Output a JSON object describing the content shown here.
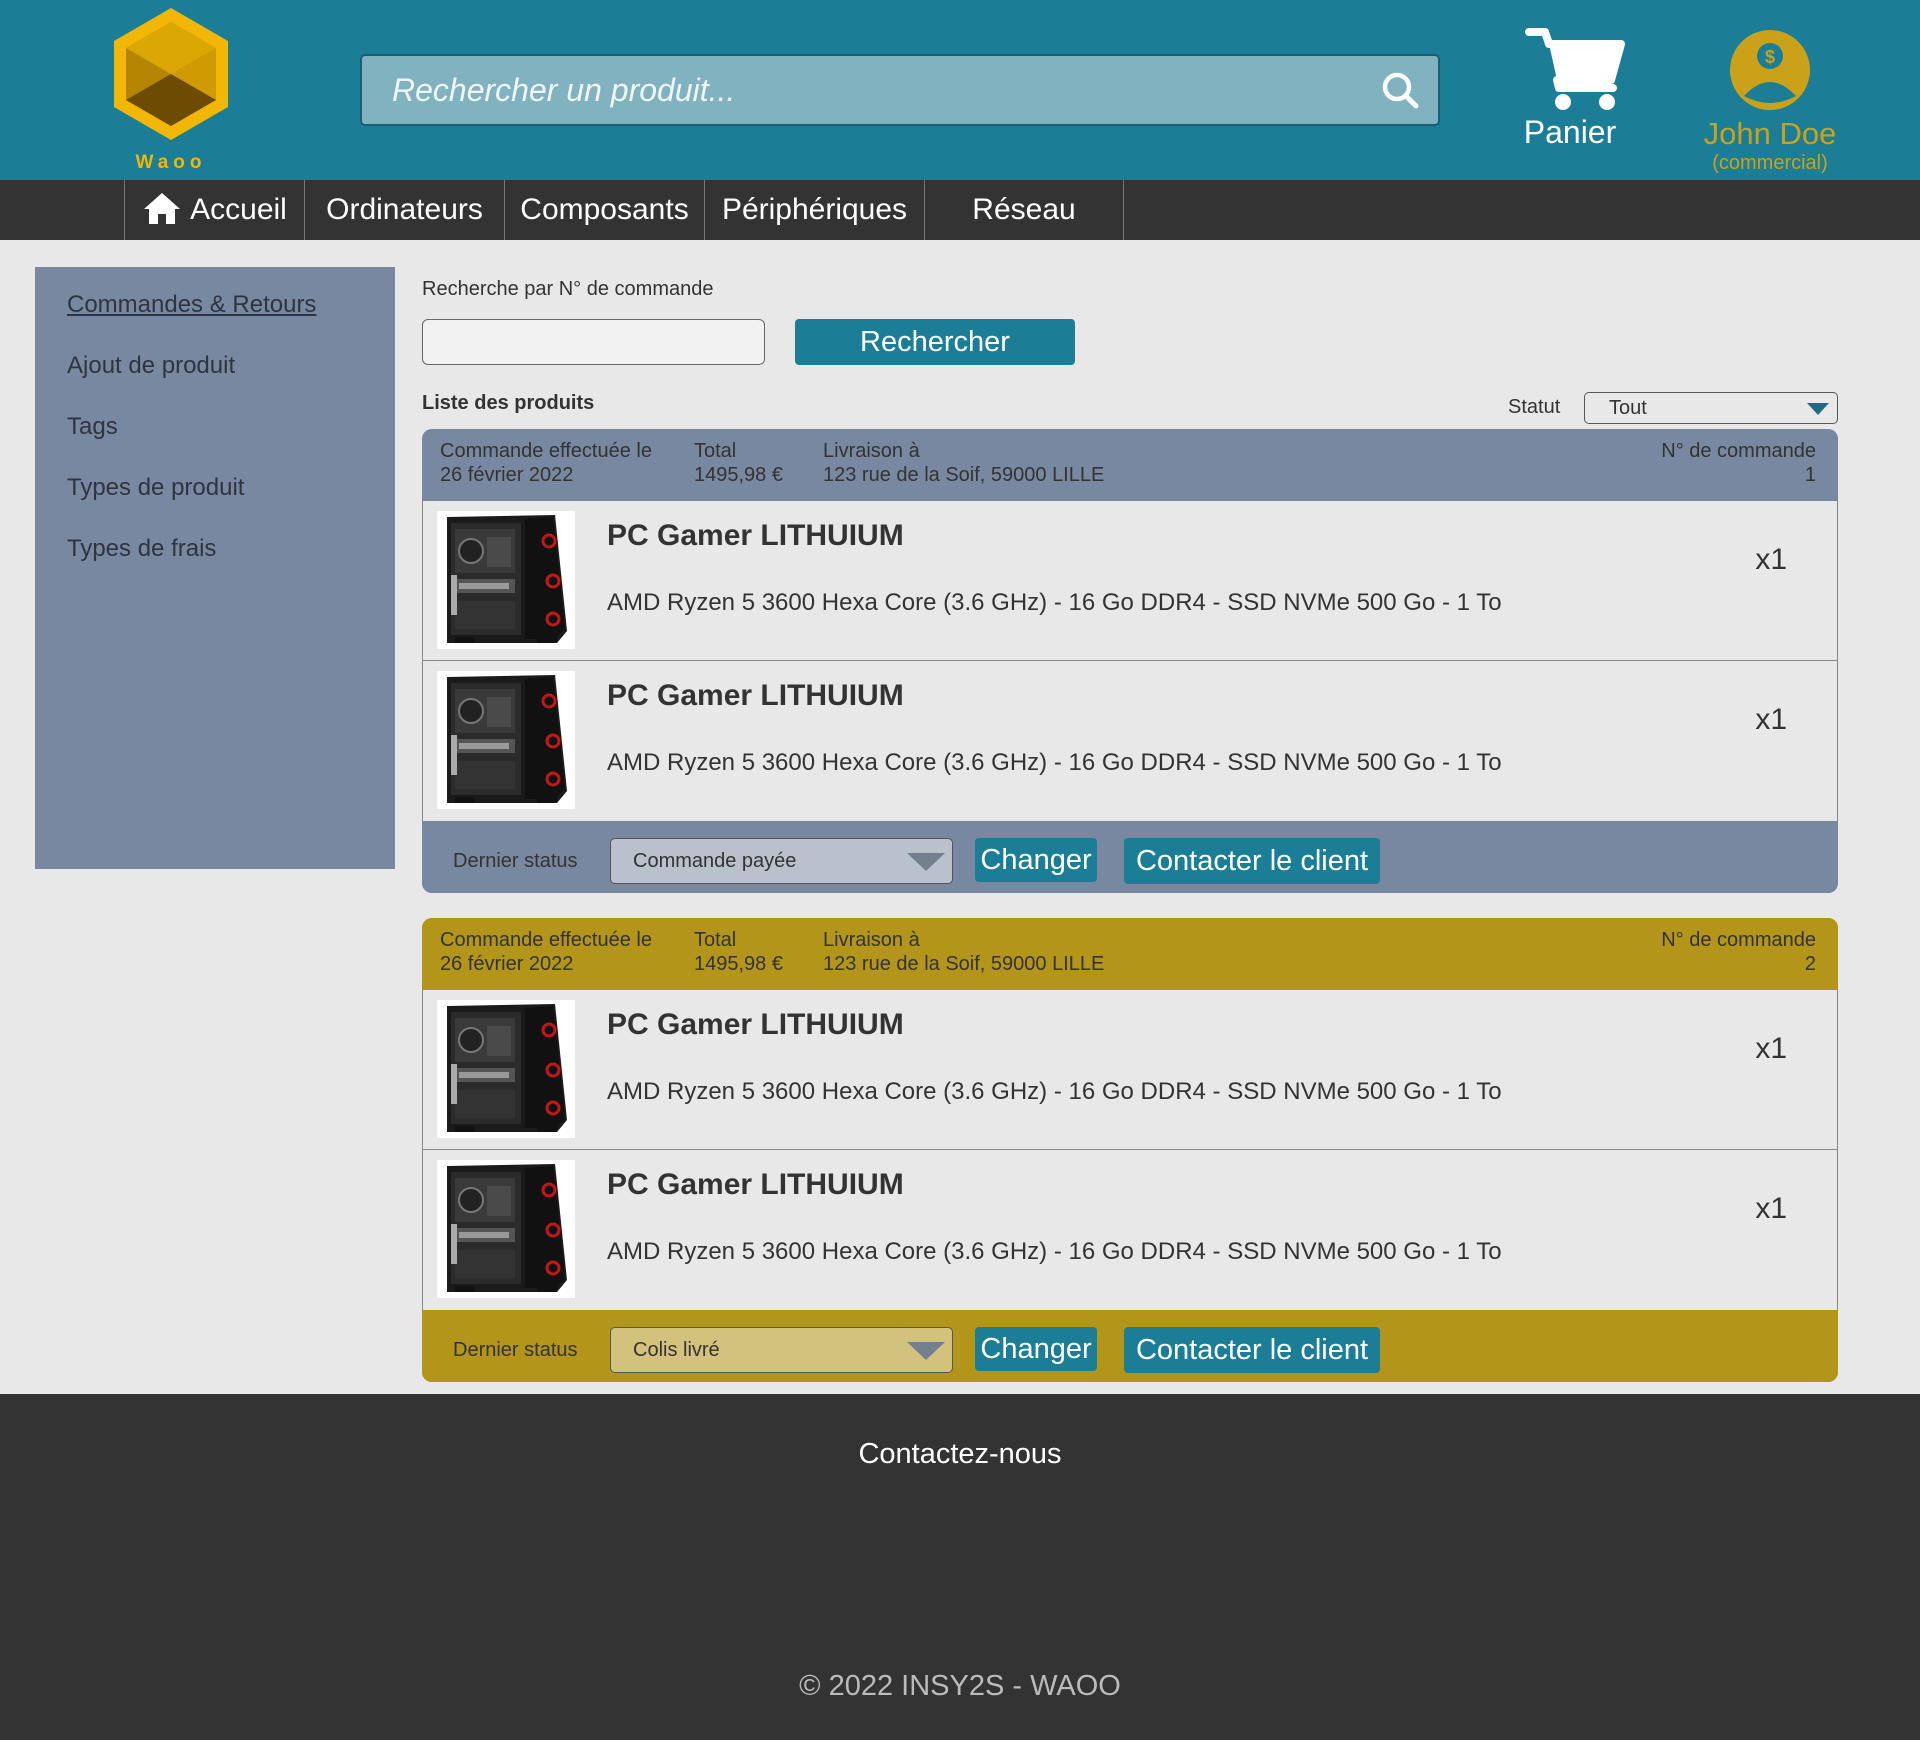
{
  "header": {
    "logo_text": "Waoo",
    "search_placeholder": "Rechercher un produit...",
    "cart_label": "Panier",
    "user_name": "John Doe",
    "user_role": "(commercial)"
  },
  "nav": {
    "items": [
      {
        "label": "Accueil",
        "icon": "home-icon"
      },
      {
        "label": "Ordinateurs"
      },
      {
        "label": "Composants"
      },
      {
        "label": "Périphériques"
      },
      {
        "label": "Réseau"
      }
    ]
  },
  "sidebar": {
    "items": [
      {
        "label": "Commandes & Retours"
      },
      {
        "label": "Ajout de produit"
      },
      {
        "label": "Tags"
      },
      {
        "label": "Types de produit"
      },
      {
        "label": "Types de frais"
      }
    ]
  },
  "order_search": {
    "label": "Recherche par N° de commande",
    "value": "",
    "button": "Rechercher"
  },
  "list": {
    "title": "Liste des produits",
    "statut_label": "Statut",
    "statut_value": "Tout"
  },
  "orders": [
    {
      "date_label": "Commande effectuée le",
      "date": "26 février 2022",
      "total_label": "Total",
      "total": "1495,98 €",
      "delivery_label": "Livraison à",
      "delivery": "123 rue de la Soif, 59000 LILLE",
      "number_label": "N° de commande",
      "number": "1",
      "color": "#7888a0",
      "select_color": "#b9c1cd",
      "items": [
        {
          "name": "PC Gamer LITHUIUM",
          "desc": "AMD Ryzen 5 3600 Hexa Core (3.6 GHz) - 16 Go DDR4 - SSD NVMe 500 Go - 1 To",
          "qty": "x1"
        },
        {
          "name": "PC Gamer LITHUIUM",
          "desc": "AMD Ryzen 5 3600 Hexa Core (3.6 GHz) - 16 Go DDR4 - SSD NVMe 500 Go - 1 To",
          "qty": "x1"
        }
      ],
      "status_label": "Dernier status",
      "status_value": "Commande payée",
      "change_button": "Changer",
      "contact_button": "Contacter le client"
    },
    {
      "date_label": "Commande effectuée le",
      "date": "26 février 2022",
      "total_label": "Total",
      "total": "1495,98 €",
      "delivery_label": "Livraison à",
      "delivery": "123 rue de la Soif, 59000 LILLE",
      "number_label": "N° de commande",
      "number": "2",
      "color": "#b3951a",
      "select_color": "#d3c27d",
      "items": [
        {
          "name": "PC Gamer LITHUIUM",
          "desc": "AMD Ryzen 5 3600 Hexa Core (3.6 GHz) - 16 Go DDR4 - SSD NVMe 500 Go - 1 To",
          "qty": "x1"
        },
        {
          "name": "PC Gamer LITHUIUM",
          "desc": "AMD Ryzen 5 3600 Hexa Core (3.6 GHz) - 16 Go DDR4 - SSD NVMe 500 Go - 1 To",
          "qty": "x1"
        }
      ],
      "status_label": "Dernier status",
      "status_value": "Colis livré",
      "change_button": "Changer",
      "contact_button": "Contacter le client"
    }
  ],
  "footer": {
    "title": "Contactez-nous",
    "copyright": "© 2022 INSY2S - WAOO"
  },
  "colors": {
    "primary": "#1b7e96",
    "accent": "#f2b705",
    "dark": "#333333"
  }
}
